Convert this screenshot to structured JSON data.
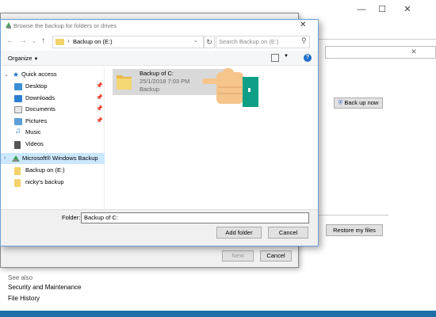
{
  "colors": {
    "accent": "#1e6ec8",
    "selection": "#cce8ff",
    "folder": "#f3d16b",
    "taskbar": "#1d6fa8"
  },
  "background_window": {
    "caption_icons": [
      "minimize-icon",
      "maximize-icon",
      "close-icon"
    ],
    "search_clear_icon": "close-icon",
    "backup_now_label": "Back up now",
    "restore_files_label": "Restore my files",
    "see_also": "See also",
    "links": [
      "Security and Maintenance",
      "File History"
    ]
  },
  "wizard": {
    "next_label": "Next",
    "cancel_label": "Cancel"
  },
  "dialog": {
    "title": "Browse the backup for folders or drives",
    "address": "Backup on (E:)",
    "search_placeholder": "Search Backup on (E:)",
    "organize_label": "Organize",
    "nav": {
      "quick_access": "Quick access",
      "items": [
        {
          "label": "Desktop",
          "icon": "desktop-icon",
          "pinned": true
        },
        {
          "label": "Downloads",
          "icon": "download-icon",
          "pinned": true
        },
        {
          "label": "Documents",
          "icon": "documents-icon",
          "pinned": true
        },
        {
          "label": "Pictures",
          "icon": "pictures-icon",
          "pinned": true
        },
        {
          "label": "Music",
          "icon": "music-icon",
          "pinned": false
        },
        {
          "label": "Videos",
          "icon": "videos-icon",
          "pinned": false
        }
      ],
      "windows_backup": "Microsoft® Windows Backup",
      "backup_items": [
        "Backup on (E:)",
        "nicky's backup"
      ]
    },
    "file": {
      "name": "Backup of C:",
      "date": "25/1/2018 7:03 PM",
      "type": "Backup"
    },
    "folder_label": "Folder:",
    "folder_value": "Backup of C:",
    "add_folder_label": "Add folder",
    "cancel_label": "Cancel"
  }
}
